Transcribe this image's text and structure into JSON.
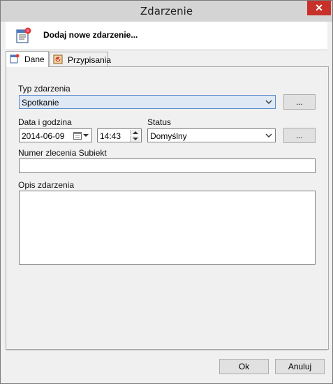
{
  "window": {
    "title": "Zdarzenie",
    "close_glyph": "✕"
  },
  "header": {
    "title": "Dodaj nowe zdarzenie..."
  },
  "tabs": [
    {
      "label": "Dane",
      "active": true
    },
    {
      "label": "Przypisania",
      "active": false
    }
  ],
  "form": {
    "type_label": "Typ zdarzenia",
    "type_value": "Spotkanie",
    "type_browse": "...",
    "datetime_label": "Data i godzina",
    "date_value": "2014-06-09",
    "time_value": "14:43",
    "status_label": "Status",
    "status_value": "Domyślny",
    "status_browse": "...",
    "order_label": "Numer zlecenia Subiekt",
    "order_value": "",
    "desc_label": "Opis zdarzenia",
    "desc_value": ""
  },
  "footer": {
    "ok_label": "Ok",
    "cancel_label": "Anuluj"
  },
  "colors": {
    "close_button": "#c7312a",
    "selected_field": "#dfe9f5"
  }
}
